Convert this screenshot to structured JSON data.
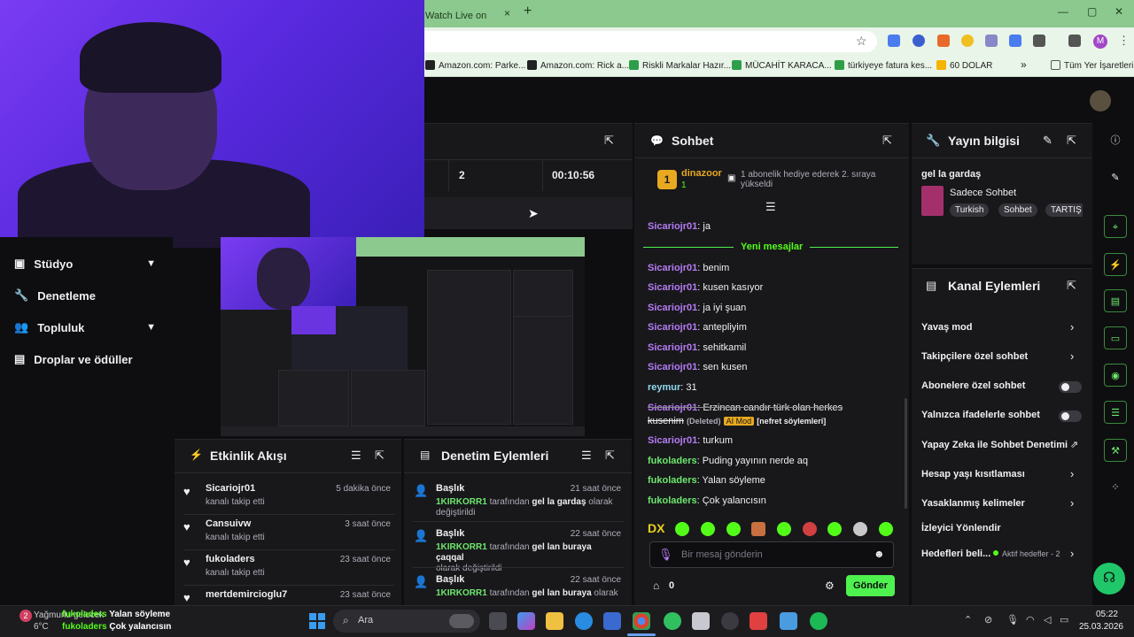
{
  "browser": {
    "tab_title": "Watch Live on",
    "tab_close": "×",
    "new_tab": "+",
    "window_min": "—",
    "window_max": "▢",
    "window_close": "✕",
    "profile_initial": "M",
    "bookmarks": [
      {
        "label": "Amazon.com: Parke...",
        "color": "#222"
      },
      {
        "label": "Amazon.com: Rick a...",
        "color": "#222"
      },
      {
        "label": "Riskli Markalar Hazır...",
        "color": "#2e9e4a"
      },
      {
        "label": "MÜCAHİT KARACA...",
        "color": "#2e9e4a"
      },
      {
        "label": "türkiyeye fatura kes...",
        "color": "#2e9e4a"
      },
      {
        "label": "60 DOLAR",
        "color": "#f4b400"
      }
    ],
    "bookmarks_more": "»",
    "all_bookmarks": "Tüm Yer İşaretleri"
  },
  "nav": {
    "studio": "Stüdyo",
    "moderation": "Denetleme",
    "community": "Topluluk",
    "drops": "Droplar ve ödüller"
  },
  "stats": {
    "viewers": "2",
    "uptime": "00:10:56"
  },
  "chat": {
    "title": "Sohbet",
    "gift_user": "dinazoor",
    "gift_count": "1",
    "gift_badge": "1",
    "gift_text": "1 abonelik hediye ederek 2. sıraya yükseldi",
    "new_messages": "Yeni mesajlar",
    "messages": [
      {
        "user": "Sicariojr01",
        "text": ": ja",
        "color": "purple"
      },
      {
        "user": "Sicariojr01",
        "text": ": benim",
        "color": "purple"
      },
      {
        "user": "Sicariojr01",
        "text": ": kusen kasıyor",
        "color": "purple"
      },
      {
        "user": "Sicariojr01",
        "text": ": ja iyi şuan",
        "color": "purple"
      },
      {
        "user": "Sicariojr01",
        "text": ": antepliyim",
        "color": "purple"
      },
      {
        "user": "Sicariojr01",
        "text": ": sehitkamil",
        "color": "purple"
      },
      {
        "user": "Sicariojr01",
        "text": ": sen kusen",
        "color": "purple"
      },
      {
        "user": "reymur",
        "text": ": 31",
        "color": "cyan"
      },
      {
        "user": "Sicariojr01",
        "text": ": Erzincan candır türk olan herkes",
        "color": "purple"
      },
      {
        "user": "Sicariojr01",
        "text": ": turkum",
        "color": "purple"
      },
      {
        "user": "fukoladers",
        "text": ": Puding yayının nerde aq",
        "color": "green"
      },
      {
        "user": "fukoladers",
        "text": ": Yalan söyleme",
        "color": "green"
      },
      {
        "user": "fukoladers",
        "text": ": Çok yalancısın",
        "color": "green"
      }
    ],
    "deleted_line": "kusenim",
    "deleted_tag": "(Deleted)",
    "ai_mod": "AI Mod",
    "deleted_reason": "[nefret söylemleri]",
    "input_placeholder": "Bir mesaj gönderin",
    "points": "0",
    "send": "Gönder",
    "emote_first": "DX"
  },
  "info": {
    "title": "Yayın bilgisi",
    "stream_title": "gel la gardaş",
    "category": "Sadece Sohbet",
    "tags": [
      "Turkish",
      "Sohbet",
      "TARTIŞ"
    ]
  },
  "channel_actions": {
    "title": "Kanal Eylemleri",
    "items": [
      "Yavaş mod",
      "Takipçilere özel sohbet",
      "Abonelere özel sohbet",
      "Yalnızca ifadelerle sohbet",
      "Yapay Zeka ile Sohbet Denetimi",
      "Hesap yaşı kısıtlaması",
      "Yasaklanmış kelimeler",
      "İzleyici Yönlendir",
      "Hedefleri beli..."
    ],
    "goals_badge": "Aktif hedefler - 2"
  },
  "activity": {
    "title": "Etkinlik Akışı",
    "items": [
      {
        "name": "Sicariojr01",
        "sub": "kanalı takip etti",
        "time": "5 dakika önce"
      },
      {
        "name": "Cansuivw",
        "sub": "kanalı takip etti",
        "time": "3 saat önce"
      },
      {
        "name": "fukoladers",
        "sub": "kanalı takip etti",
        "time": "23 saat önce"
      },
      {
        "name": "mertdemircioglu7",
        "sub": "",
        "time": "23 saat önce"
      }
    ]
  },
  "mod_actions": {
    "title": "Denetim Eylemleri",
    "items": [
      {
        "label": "Başlık",
        "by": "1KIRKORR1",
        "mid": " tarafından ",
        "value": "gel la gardaş",
        "end": " olarak",
        "line2": "değiştirildi",
        "time": "21 saat önce"
      },
      {
        "label": "Başlık",
        "by": "1KIRKORR1",
        "mid": " tarafından ",
        "value": "gel lan buraya çaqqal",
        "end": "",
        "line2": "olarak değiştirildi",
        "time": "22 saat önce"
      },
      {
        "label": "Başlık",
        "by": "1KIRKORR1",
        "mid": " tarafından ",
        "value": "gel lan buraya",
        "end": " olarak",
        "line2": "",
        "time": "22 saat önce"
      }
    ]
  },
  "taskbar": {
    "weather_temp": "6°C",
    "weather_text": "Yağmurlu gelecek",
    "overlay_user1": "fukoladers",
    "overlay_msg1": "Yalan söyleme",
    "overlay_user2": "fukoladers",
    "overlay_msg2": "Çok yalancısın",
    "search": "Ara",
    "time": "05:22",
    "date": "25.03.2026",
    "badge": "2"
  },
  "colors": {
    "accent": "#53fc18",
    "purple_user": "#b57cf5",
    "green_user": "#6de86d"
  }
}
